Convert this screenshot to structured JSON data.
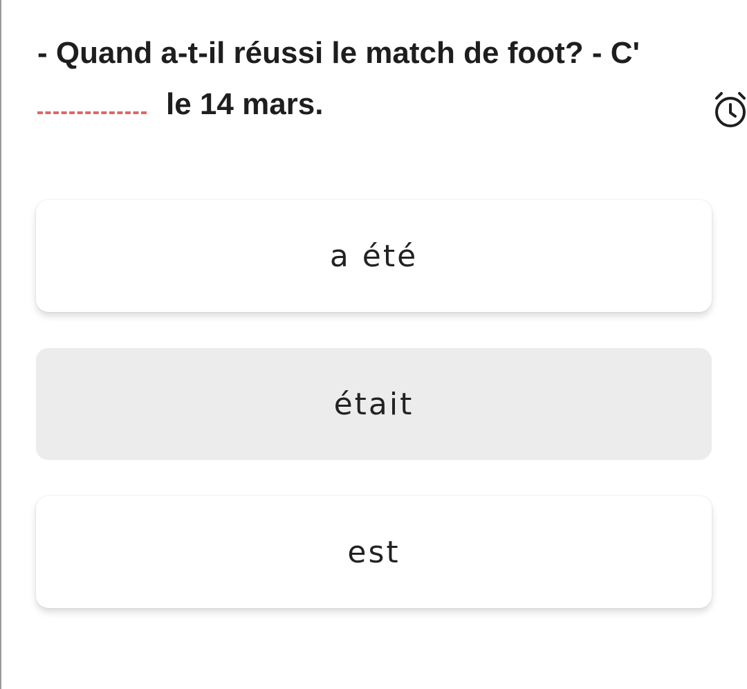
{
  "question": {
    "line1": "- Quand a-t-il réussi le match de foot? - C'",
    "line2_after_blank": "le 14 mars."
  },
  "timer": {
    "icon": "alarm-clock-icon"
  },
  "options": [
    {
      "label": "a été",
      "state": "default"
    },
    {
      "label": "était",
      "state": "selected"
    },
    {
      "label": "est",
      "state": "default"
    }
  ],
  "colors": {
    "blank_underline": "#e06666",
    "selected_option_bg": "#ececec",
    "option_bg": "#ffffff"
  }
}
